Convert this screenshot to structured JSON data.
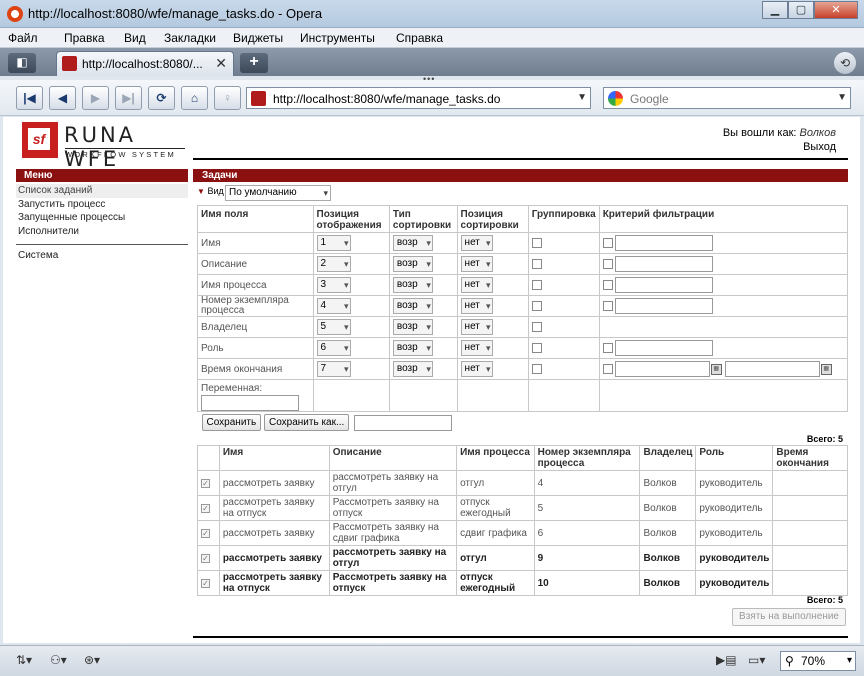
{
  "window": {
    "title": "http://localhost:8080/wfe/manage_tasks.do - Opera"
  },
  "menubar": [
    "Файл",
    "Правка",
    "Вид",
    "Закладки",
    "Виджеты",
    "Инструменты",
    "Справка"
  ],
  "tab": {
    "title": "http://localhost:8080/..."
  },
  "address": {
    "url": "http://localhost:8080/wfe/manage_tasks.do"
  },
  "search": {
    "placeholder": "Google"
  },
  "logo": {
    "name": "RUNA WFE",
    "subtitle": "WORKFLOW SYSTEM"
  },
  "login": {
    "label": "Вы вошли как:",
    "user": "Волков",
    "logout": "Выход"
  },
  "sidebar": {
    "title": "Меню",
    "items": [
      "Список заданий",
      "Запустить процесс",
      "Запущенные процессы",
      "Исполнители"
    ],
    "system": "Система"
  },
  "section": {
    "title": "Задачи",
    "view_label": "Вид",
    "view_value": "По умолчанию"
  },
  "config": {
    "headers": [
      "Имя поля",
      "Позиция отображения",
      "Тип сортировки",
      "Позиция сортировки",
      "Группировка",
      "Критерий фильтрации"
    ],
    "rows": [
      {
        "field": "Имя",
        "pos": "1",
        "sort": "возр",
        "sortpos": "нет"
      },
      {
        "field": "Описание",
        "pos": "2",
        "sort": "возр",
        "sortpos": "нет"
      },
      {
        "field": "Имя процесса",
        "pos": "3",
        "sort": "возр",
        "sortpos": "нет"
      },
      {
        "field": "Номер экземпляра процесса",
        "pos": "4",
        "sort": "возр",
        "sortpos": "нет"
      },
      {
        "field": "Владелец",
        "pos": "5",
        "sort": "возр",
        "sortpos": "нет"
      },
      {
        "field": "Роль",
        "pos": "6",
        "sort": "возр",
        "sortpos": "нет"
      },
      {
        "field": "Время окончания",
        "pos": "7",
        "sort": "возр",
        "sortpos": "нет"
      }
    ],
    "variable_label": "Переменная:",
    "save": "Сохранить",
    "save_as": "Сохранить как..."
  },
  "tasks": {
    "total_label": "Всего: 5",
    "headers": [
      "Имя",
      "Описание",
      "Имя процесса",
      "Номер экземпляра процесса",
      "Владелец",
      "Роль",
      "Время окончания"
    ],
    "rows": [
      {
        "name": "рассмотреть заявку",
        "desc": "рассмотреть заявку на отгул",
        "proc": "отгул",
        "num": "4",
        "owner": "Волков",
        "role": "руководитель"
      },
      {
        "name": "рассмотреть заявку на отпуск",
        "desc": "Рассмотреть заявку на отпуск",
        "proc": "отпуск ежегодный",
        "num": "5",
        "owner": "Волков",
        "role": "руководитель"
      },
      {
        "name": "рассмотреть заявку",
        "desc": "Рассмотреть заявку на сдвиг графика",
        "proc": "сдвиг графика",
        "num": "6",
        "owner": "Волков",
        "role": "руководитель"
      },
      {
        "name": "рассмотреть заявку",
        "desc": "рассмотреть заявку на отгул",
        "proc": "отгул",
        "num": "9",
        "owner": "Волков",
        "role": "руководитель"
      },
      {
        "name": "рассмотреть заявку на отпуск",
        "desc": "Рассмотреть заявку на отпуск",
        "proc": "отпуск ежегодный",
        "num": "10",
        "owner": "Волков",
        "role": "руководитель"
      }
    ],
    "take_button": "Взять на выполнение"
  },
  "status": {
    "zoom": "70%"
  }
}
